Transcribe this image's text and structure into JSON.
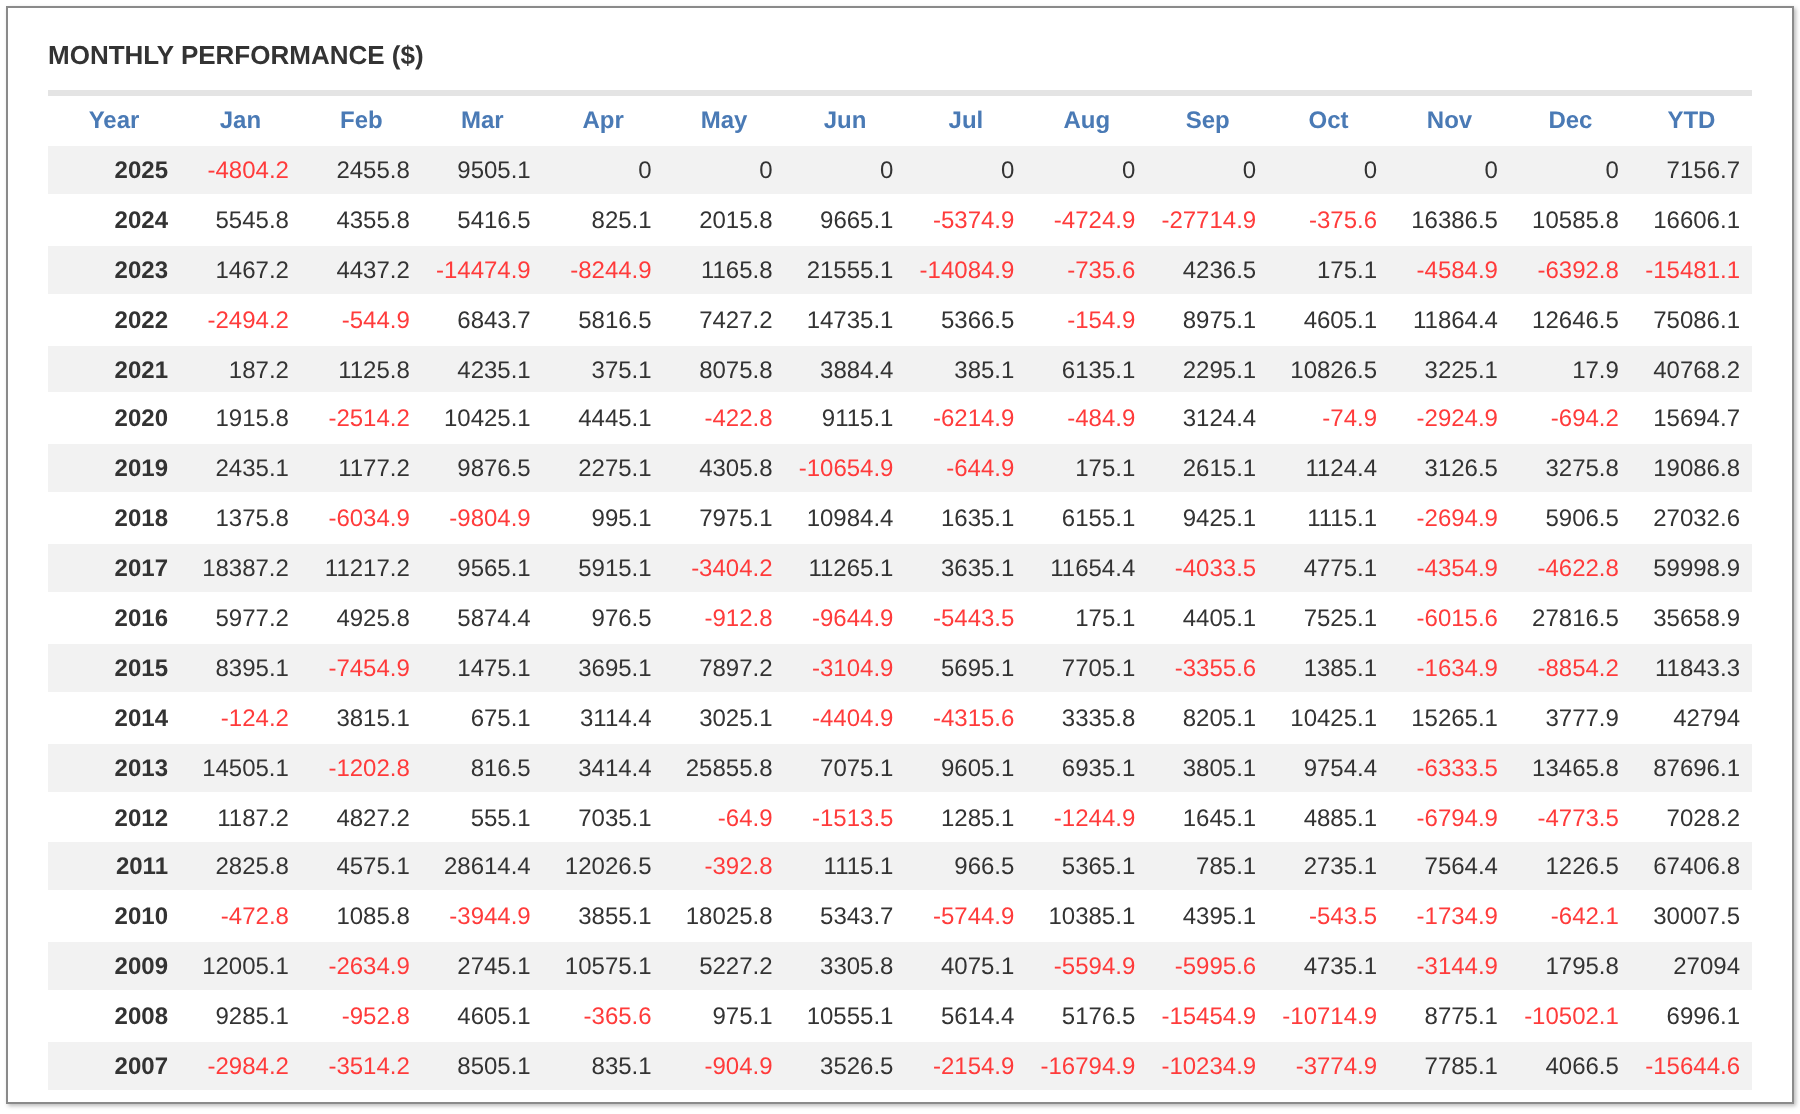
{
  "title": "MONTHLY PERFORMANCE ($)",
  "columns": [
    "Year",
    "Jan",
    "Feb",
    "Mar",
    "Apr",
    "May",
    "Jun",
    "Jul",
    "Aug",
    "Sep",
    "Oct",
    "Nov",
    "Dec",
    "YTD"
  ],
  "rows": [
    {
      "year": "2025",
      "cells": [
        {
          "text": "-4804.2",
          "negative": true
        },
        {
          "text": "2455.8",
          "negative": false
        },
        {
          "text": "9505.1",
          "negative": false
        },
        {
          "text": "0",
          "negative": false
        },
        {
          "text": "0",
          "negative": false
        },
        {
          "text": "0",
          "negative": false
        },
        {
          "text": "0",
          "negative": false
        },
        {
          "text": "0",
          "negative": false
        },
        {
          "text": "0",
          "negative": false
        },
        {
          "text": "0",
          "negative": false
        },
        {
          "text": "0",
          "negative": false
        },
        {
          "text": "0",
          "negative": false
        },
        {
          "text": "7156.7",
          "negative": false
        }
      ]
    },
    {
      "year": "2024",
      "cells": [
        {
          "text": "5545.8",
          "negative": false
        },
        {
          "text": "4355.8",
          "negative": false
        },
        {
          "text": "5416.5",
          "negative": false
        },
        {
          "text": "825.1",
          "negative": false
        },
        {
          "text": "2015.8",
          "negative": false
        },
        {
          "text": "9665.1",
          "negative": false
        },
        {
          "text": "-5374.9",
          "negative": true
        },
        {
          "text": "-4724.9",
          "negative": true
        },
        {
          "text": "-27714.9",
          "negative": true
        },
        {
          "text": "-375.6",
          "negative": true
        },
        {
          "text": "16386.5",
          "negative": false
        },
        {
          "text": "10585.8",
          "negative": false
        },
        {
          "text": "16606.1",
          "negative": false
        }
      ]
    },
    {
      "year": "2023",
      "cells": [
        {
          "text": "1467.2",
          "negative": false
        },
        {
          "text": "4437.2",
          "negative": false
        },
        {
          "text": "-14474.9",
          "negative": true
        },
        {
          "text": "-8244.9",
          "negative": true
        },
        {
          "text": "1165.8",
          "negative": false
        },
        {
          "text": "21555.1",
          "negative": false
        },
        {
          "text": "-14084.9",
          "negative": true
        },
        {
          "text": "-735.6",
          "negative": true
        },
        {
          "text": "4236.5",
          "negative": false
        },
        {
          "text": "175.1",
          "negative": false
        },
        {
          "text": "-4584.9",
          "negative": true
        },
        {
          "text": "-6392.8",
          "negative": true
        },
        {
          "text": "-15481.1",
          "negative": true
        }
      ]
    },
    {
      "year": "2022",
      "cells": [
        {
          "text": "-2494.2",
          "negative": true
        },
        {
          "text": "-544.9",
          "negative": true
        },
        {
          "text": "6843.7",
          "negative": false
        },
        {
          "text": "5816.5",
          "negative": false
        },
        {
          "text": "7427.2",
          "negative": false
        },
        {
          "text": "14735.1",
          "negative": false
        },
        {
          "text": "5366.5",
          "negative": false
        },
        {
          "text": "-154.9",
          "negative": true
        },
        {
          "text": "8975.1",
          "negative": false
        },
        {
          "text": "4605.1",
          "negative": false
        },
        {
          "text": "11864.4",
          "negative": false
        },
        {
          "text": "12646.5",
          "negative": false
        },
        {
          "text": "75086.1",
          "negative": false
        }
      ]
    },
    {
      "year": "2021",
      "cells": [
        {
          "text": "187.2",
          "negative": false
        },
        {
          "text": "1125.8",
          "negative": false
        },
        {
          "text": "4235.1",
          "negative": false
        },
        {
          "text": "375.1",
          "negative": false
        },
        {
          "text": "8075.8",
          "negative": false
        },
        {
          "text": "3884.4",
          "negative": false
        },
        {
          "text": "385.1",
          "negative": false
        },
        {
          "text": "6135.1",
          "negative": false
        },
        {
          "text": "2295.1",
          "negative": false
        },
        {
          "text": "10826.5",
          "negative": false
        },
        {
          "text": "3225.1",
          "negative": false
        },
        {
          "text": "17.9",
          "negative": false
        },
        {
          "text": "40768.2",
          "negative": false
        }
      ]
    },
    {
      "year": "2020",
      "cells": [
        {
          "text": "1915.8",
          "negative": false
        },
        {
          "text": "-2514.2",
          "negative": true
        },
        {
          "text": "10425.1",
          "negative": false
        },
        {
          "text": "4445.1",
          "negative": false
        },
        {
          "text": "-422.8",
          "negative": true
        },
        {
          "text": "9115.1",
          "negative": false
        },
        {
          "text": "-6214.9",
          "negative": true
        },
        {
          "text": "-484.9",
          "negative": true
        },
        {
          "text": "3124.4",
          "negative": false
        },
        {
          "text": "-74.9",
          "negative": true
        },
        {
          "text": "-2924.9",
          "negative": true
        },
        {
          "text": "-694.2",
          "negative": true
        },
        {
          "text": "15694.7",
          "negative": false
        }
      ]
    },
    {
      "year": "2019",
      "cells": [
        {
          "text": "2435.1",
          "negative": false
        },
        {
          "text": "1177.2",
          "negative": false
        },
        {
          "text": "9876.5",
          "negative": false
        },
        {
          "text": "2275.1",
          "negative": false
        },
        {
          "text": "4305.8",
          "negative": false
        },
        {
          "text": "-10654.9",
          "negative": true
        },
        {
          "text": "-644.9",
          "negative": true
        },
        {
          "text": "175.1",
          "negative": false
        },
        {
          "text": "2615.1",
          "negative": false
        },
        {
          "text": "1124.4",
          "negative": false
        },
        {
          "text": "3126.5",
          "negative": false
        },
        {
          "text": "3275.8",
          "negative": false
        },
        {
          "text": "19086.8",
          "negative": false
        }
      ]
    },
    {
      "year": "2018",
      "cells": [
        {
          "text": "1375.8",
          "negative": false
        },
        {
          "text": "-6034.9",
          "negative": true
        },
        {
          "text": "-9804.9",
          "negative": true
        },
        {
          "text": "995.1",
          "negative": false
        },
        {
          "text": "7975.1",
          "negative": false
        },
        {
          "text": "10984.4",
          "negative": false
        },
        {
          "text": "1635.1",
          "negative": false
        },
        {
          "text": "6155.1",
          "negative": false
        },
        {
          "text": "9425.1",
          "negative": false
        },
        {
          "text": "1115.1",
          "negative": false
        },
        {
          "text": "-2694.9",
          "negative": true
        },
        {
          "text": "5906.5",
          "negative": false
        },
        {
          "text": "27032.6",
          "negative": false
        }
      ]
    },
    {
      "year": "2017",
      "cells": [
        {
          "text": "18387.2",
          "negative": false
        },
        {
          "text": "11217.2",
          "negative": false
        },
        {
          "text": "9565.1",
          "negative": false
        },
        {
          "text": "5915.1",
          "negative": false
        },
        {
          "text": "-3404.2",
          "negative": true
        },
        {
          "text": "11265.1",
          "negative": false
        },
        {
          "text": "3635.1",
          "negative": false
        },
        {
          "text": "11654.4",
          "negative": false
        },
        {
          "text": "-4033.5",
          "negative": true
        },
        {
          "text": "4775.1",
          "negative": false
        },
        {
          "text": "-4354.9",
          "negative": true
        },
        {
          "text": "-4622.8",
          "negative": true
        },
        {
          "text": "59998.9",
          "negative": false
        }
      ]
    },
    {
      "year": "2016",
      "cells": [
        {
          "text": "5977.2",
          "negative": false
        },
        {
          "text": "4925.8",
          "negative": false
        },
        {
          "text": "5874.4",
          "negative": false
        },
        {
          "text": "976.5",
          "negative": false
        },
        {
          "text": "-912.8",
          "negative": true
        },
        {
          "text": "-9644.9",
          "negative": true
        },
        {
          "text": "-5443.5",
          "negative": true
        },
        {
          "text": "175.1",
          "negative": false
        },
        {
          "text": "4405.1",
          "negative": false
        },
        {
          "text": "7525.1",
          "negative": false
        },
        {
          "text": "-6015.6",
          "negative": true
        },
        {
          "text": "27816.5",
          "negative": false
        },
        {
          "text": "35658.9",
          "negative": false
        }
      ]
    },
    {
      "year": "2015",
      "cells": [
        {
          "text": "8395.1",
          "negative": false
        },
        {
          "text": "-7454.9",
          "negative": true
        },
        {
          "text": "1475.1",
          "negative": false
        },
        {
          "text": "3695.1",
          "negative": false
        },
        {
          "text": "7897.2",
          "negative": false
        },
        {
          "text": "-3104.9",
          "negative": true
        },
        {
          "text": "5695.1",
          "negative": false
        },
        {
          "text": "7705.1",
          "negative": false
        },
        {
          "text": "-3355.6",
          "negative": true
        },
        {
          "text": "1385.1",
          "negative": false
        },
        {
          "text": "-1634.9",
          "negative": true
        },
        {
          "text": "-8854.2",
          "negative": true
        },
        {
          "text": "11843.3",
          "negative": false
        }
      ]
    },
    {
      "year": "2014",
      "cells": [
        {
          "text": "-124.2",
          "negative": true
        },
        {
          "text": "3815.1",
          "negative": false
        },
        {
          "text": "675.1",
          "negative": false
        },
        {
          "text": "3114.4",
          "negative": false
        },
        {
          "text": "3025.1",
          "negative": false
        },
        {
          "text": "-4404.9",
          "negative": true
        },
        {
          "text": "-4315.6",
          "negative": true
        },
        {
          "text": "3335.8",
          "negative": false
        },
        {
          "text": "8205.1",
          "negative": false
        },
        {
          "text": "10425.1",
          "negative": false
        },
        {
          "text": "15265.1",
          "negative": false
        },
        {
          "text": "3777.9",
          "negative": false
        },
        {
          "text": "42794",
          "negative": false
        }
      ]
    },
    {
      "year": "2013",
      "cells": [
        {
          "text": "14505.1",
          "negative": false
        },
        {
          "text": "-1202.8",
          "negative": true
        },
        {
          "text": "816.5",
          "negative": false
        },
        {
          "text": "3414.4",
          "negative": false
        },
        {
          "text": "25855.8",
          "negative": false
        },
        {
          "text": "7075.1",
          "negative": false
        },
        {
          "text": "9605.1",
          "negative": false
        },
        {
          "text": "6935.1",
          "negative": false
        },
        {
          "text": "3805.1",
          "negative": false
        },
        {
          "text": "9754.4",
          "negative": false
        },
        {
          "text": "-6333.5",
          "negative": true
        },
        {
          "text": "13465.8",
          "negative": false
        },
        {
          "text": "87696.1",
          "negative": false
        }
      ]
    },
    {
      "year": "2012",
      "cells": [
        {
          "text": "1187.2",
          "negative": false
        },
        {
          "text": "4827.2",
          "negative": false
        },
        {
          "text": "555.1",
          "negative": false
        },
        {
          "text": "7035.1",
          "negative": false
        },
        {
          "text": "-64.9",
          "negative": true
        },
        {
          "text": "-1513.5",
          "negative": true
        },
        {
          "text": "1285.1",
          "negative": false
        },
        {
          "text": "-1244.9",
          "negative": true
        },
        {
          "text": "1645.1",
          "negative": false
        },
        {
          "text": "4885.1",
          "negative": false
        },
        {
          "text": "-6794.9",
          "negative": true
        },
        {
          "text": "-4773.5",
          "negative": true
        },
        {
          "text": "7028.2",
          "negative": false
        }
      ]
    },
    {
      "year": "2011",
      "cells": [
        {
          "text": "2825.8",
          "negative": false
        },
        {
          "text": "4575.1",
          "negative": false
        },
        {
          "text": "28614.4",
          "negative": false
        },
        {
          "text": "12026.5",
          "negative": false
        },
        {
          "text": "-392.8",
          "negative": true
        },
        {
          "text": "1115.1",
          "negative": false
        },
        {
          "text": "966.5",
          "negative": false
        },
        {
          "text": "5365.1",
          "negative": false
        },
        {
          "text": "785.1",
          "negative": false
        },
        {
          "text": "2735.1",
          "negative": false
        },
        {
          "text": "7564.4",
          "negative": false
        },
        {
          "text": "1226.5",
          "negative": false
        },
        {
          "text": "67406.8",
          "negative": false
        }
      ]
    },
    {
      "year": "2010",
      "cells": [
        {
          "text": "-472.8",
          "negative": true
        },
        {
          "text": "1085.8",
          "negative": false
        },
        {
          "text": "-3944.9",
          "negative": true
        },
        {
          "text": "3855.1",
          "negative": false
        },
        {
          "text": "18025.8",
          "negative": false
        },
        {
          "text": "5343.7",
          "negative": false
        },
        {
          "text": "-5744.9",
          "negative": true
        },
        {
          "text": "10385.1",
          "negative": false
        },
        {
          "text": "4395.1",
          "negative": false
        },
        {
          "text": "-543.5",
          "negative": true
        },
        {
          "text": "-1734.9",
          "negative": true
        },
        {
          "text": "-642.1",
          "negative": true
        },
        {
          "text": "30007.5",
          "negative": false
        }
      ]
    },
    {
      "year": "2009",
      "cells": [
        {
          "text": "12005.1",
          "negative": false
        },
        {
          "text": "-2634.9",
          "negative": true
        },
        {
          "text": "2745.1",
          "negative": false
        },
        {
          "text": "10575.1",
          "negative": false
        },
        {
          "text": "5227.2",
          "negative": false
        },
        {
          "text": "3305.8",
          "negative": false
        },
        {
          "text": "4075.1",
          "negative": false
        },
        {
          "text": "-5594.9",
          "negative": true
        },
        {
          "text": "-5995.6",
          "negative": true
        },
        {
          "text": "4735.1",
          "negative": false
        },
        {
          "text": "-3144.9",
          "negative": true
        },
        {
          "text": "1795.8",
          "negative": false
        },
        {
          "text": "27094",
          "negative": false
        }
      ]
    },
    {
      "year": "2008",
      "cells": [
        {
          "text": "9285.1",
          "negative": false
        },
        {
          "text": "-952.8",
          "negative": true
        },
        {
          "text": "4605.1",
          "negative": false
        },
        {
          "text": "-365.6",
          "negative": true
        },
        {
          "text": "975.1",
          "negative": false
        },
        {
          "text": "10555.1",
          "negative": false
        },
        {
          "text": "5614.4",
          "negative": false
        },
        {
          "text": "5176.5",
          "negative": false
        },
        {
          "text": "-15454.9",
          "negative": true
        },
        {
          "text": "-10714.9",
          "negative": true
        },
        {
          "text": "8775.1",
          "negative": false
        },
        {
          "text": "-10502.1",
          "negative": true
        },
        {
          "text": "6996.1",
          "negative": false
        }
      ]
    },
    {
      "year": "2007",
      "cells": [
        {
          "text": "-2984.2",
          "negative": true
        },
        {
          "text": "-3514.2",
          "negative": true
        },
        {
          "text": "8505.1",
          "negative": false
        },
        {
          "text": "835.1",
          "negative": false
        },
        {
          "text": "-904.9",
          "negative": true
        },
        {
          "text": "3526.5",
          "negative": false
        },
        {
          "text": "-2154.9",
          "negative": true
        },
        {
          "text": "-16794.9",
          "negative": true
        },
        {
          "text": "-10234.9",
          "negative": true
        },
        {
          "text": "-3774.9",
          "negative": true
        },
        {
          "text": "7785.1",
          "negative": false
        },
        {
          "text": "4066.5",
          "negative": false
        },
        {
          "text": "-15644.6",
          "negative": true
        }
      ]
    }
  ]
}
